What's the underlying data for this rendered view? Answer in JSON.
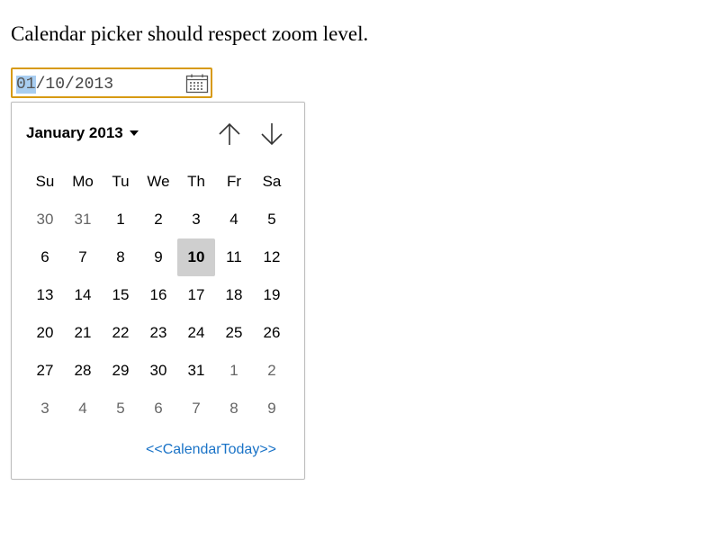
{
  "heading": "Calendar picker should respect zoom level.",
  "input": {
    "month": "01",
    "separator1": "/",
    "day": "10",
    "separator2": "/",
    "year": "2013",
    "calendar_icon": "calendar-icon"
  },
  "popup": {
    "month_year": "January 2013",
    "prev_icon": "arrow-up-icon",
    "next_icon": "arrow-down-icon",
    "weekdays": [
      "Su",
      "Mo",
      "Tu",
      "We",
      "Th",
      "Fr",
      "Sa"
    ],
    "weeks": [
      [
        {
          "d": "30",
          "other": true
        },
        {
          "d": "31",
          "other": true
        },
        {
          "d": "1"
        },
        {
          "d": "2"
        },
        {
          "d": "3"
        },
        {
          "d": "4"
        },
        {
          "d": "5"
        }
      ],
      [
        {
          "d": "6"
        },
        {
          "d": "7"
        },
        {
          "d": "8"
        },
        {
          "d": "9"
        },
        {
          "d": "10",
          "selected": true
        },
        {
          "d": "11"
        },
        {
          "d": "12"
        }
      ],
      [
        {
          "d": "13"
        },
        {
          "d": "14"
        },
        {
          "d": "15"
        },
        {
          "d": "16"
        },
        {
          "d": "17"
        },
        {
          "d": "18"
        },
        {
          "d": "19"
        }
      ],
      [
        {
          "d": "20"
        },
        {
          "d": "21"
        },
        {
          "d": "22"
        },
        {
          "d": "23"
        },
        {
          "d": "24"
        },
        {
          "d": "25"
        },
        {
          "d": "26"
        }
      ],
      [
        {
          "d": "27"
        },
        {
          "d": "28"
        },
        {
          "d": "29"
        },
        {
          "d": "30"
        },
        {
          "d": "31"
        },
        {
          "d": "1",
          "other": true
        },
        {
          "d": "2",
          "other": true
        }
      ],
      [
        {
          "d": "3",
          "other": true
        },
        {
          "d": "4",
          "other": true
        },
        {
          "d": "5",
          "other": true
        },
        {
          "d": "6",
          "other": true
        },
        {
          "d": "7",
          "other": true
        },
        {
          "d": "8",
          "other": true
        },
        {
          "d": "9",
          "other": true
        }
      ]
    ],
    "today_label": "<<CalendarToday>>"
  },
  "colors": {
    "focus_border": "#d79a13",
    "segment_highlight": "#a8cdf0",
    "selected_day_bg": "#cfcfcf",
    "link": "#1a73c7"
  }
}
